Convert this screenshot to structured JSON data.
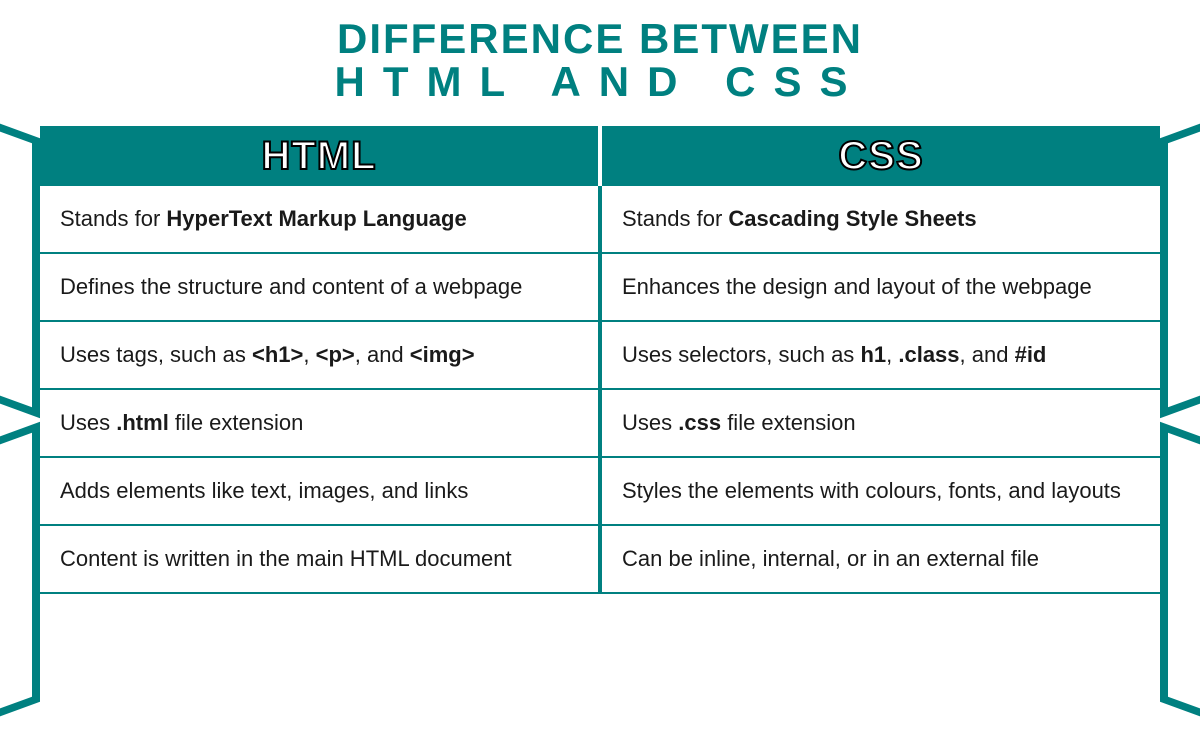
{
  "title": {
    "line1": "DIFFERENCE BETWEEN",
    "line2": "HTML AND CSS"
  },
  "headers": {
    "left": "HTML",
    "right": "CSS"
  },
  "rows": [
    {
      "left_prefix": "Stands for ",
      "left_bold": "HyperText Markup Language",
      "left_suffix": "",
      "right_prefix": "Stands for ",
      "right_bold": "Cascading Style Sheets",
      "right_suffix": ""
    },
    {
      "left_prefix": "Defines the structure and content of a webpage",
      "left_bold": "",
      "left_suffix": "",
      "right_prefix": "Enhances the design and layout of the webpage",
      "right_bold": "",
      "right_suffix": ""
    },
    {
      "left_prefix": "Uses tags, such as ",
      "left_bold": "<h1>",
      "left_mid1": ", ",
      "left_bold2": "<p>",
      "left_mid2": ", and ",
      "left_bold3": "<img>",
      "right_prefix": "Uses selectors, such as ",
      "right_bold": "h1",
      "right_mid1": ", ",
      "right_bold2": ".class",
      "right_mid2": ", and ",
      "right_bold3": "#id"
    },
    {
      "left_prefix": "Uses ",
      "left_bold": ".html",
      "left_suffix": " file extension",
      "right_prefix": "Uses ",
      "right_bold": ".css",
      "right_suffix": " file extension"
    },
    {
      "left_prefix": "Adds elements like text, images, and links",
      "left_bold": "",
      "left_suffix": "",
      "right_prefix": "Styles the elements with colours, fonts, and layouts",
      "right_bold": "",
      "right_suffix": ""
    },
    {
      "left_prefix": "Content is written in the main HTML document",
      "left_bold": "",
      "left_suffix": "",
      "right_prefix": "Can be inline, internal, or in an external file",
      "right_bold": "",
      "right_suffix": ""
    }
  ]
}
